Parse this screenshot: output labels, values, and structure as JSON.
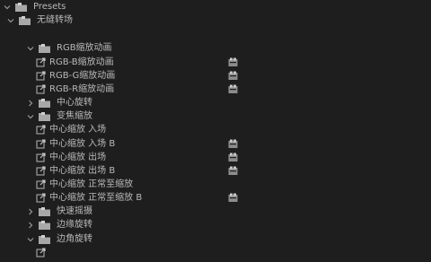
{
  "tree": {
    "rows": [
      {
        "text": "Presets",
        "type": "folder",
        "expanded": true,
        "badge": false
      },
      {
        "text": "无缝转场",
        "type": "folder",
        "expanded": true,
        "badge": false
      },
      {
        "text": "",
        "type": "blank",
        "expanded": false,
        "badge": false
      },
      {
        "text": "RGB缩放动画",
        "type": "folder",
        "expanded": true,
        "badge": false
      },
      {
        "text": "RGB-B缩放动画",
        "type": "preset",
        "expanded": false,
        "badge": true
      },
      {
        "text": "RGB-G缩放动画",
        "type": "preset",
        "expanded": false,
        "badge": true
      },
      {
        "text": "RGB-R缩放动画",
        "type": "preset",
        "expanded": false,
        "badge": true
      },
      {
        "text": "中心旋转",
        "type": "folder",
        "expanded": false,
        "badge": false
      },
      {
        "text": "变焦缩放",
        "type": "folder",
        "expanded": true,
        "badge": false
      },
      {
        "text": "中心缩放 入场",
        "type": "preset",
        "expanded": false,
        "badge": false
      },
      {
        "text": "中心缩放 入场 B",
        "type": "preset",
        "expanded": false,
        "badge": true
      },
      {
        "text": "中心缩放 出场",
        "type": "preset",
        "expanded": false,
        "badge": true
      },
      {
        "text": "中心缩放 出场 B",
        "type": "preset",
        "expanded": false,
        "badge": true
      },
      {
        "text": "中心缩放 正常至缩放",
        "type": "preset",
        "expanded": false,
        "badge": false
      },
      {
        "text": "中心缩放 正常至缩放 B",
        "type": "preset",
        "expanded": false,
        "badge": true
      },
      {
        "text": "快速摇摄",
        "type": "folder",
        "expanded": false,
        "badge": false
      },
      {
        "text": "边缘旋转",
        "type": "folder",
        "expanded": false,
        "badge": false
      },
      {
        "text": "边角旋转",
        "type": "folder",
        "expanded": true,
        "badge": false
      },
      {
        "text": "",
        "type": "preset",
        "expanded": false,
        "badge": false
      }
    ]
  },
  "icons": {
    "folder": "folder-icon",
    "preset": "preset-icon",
    "badge": "accelerated-effect-icon"
  },
  "colors": {
    "background": "#1e1e1e",
    "text": "#b9b9b9",
    "icon": "#a8a8a8"
  }
}
